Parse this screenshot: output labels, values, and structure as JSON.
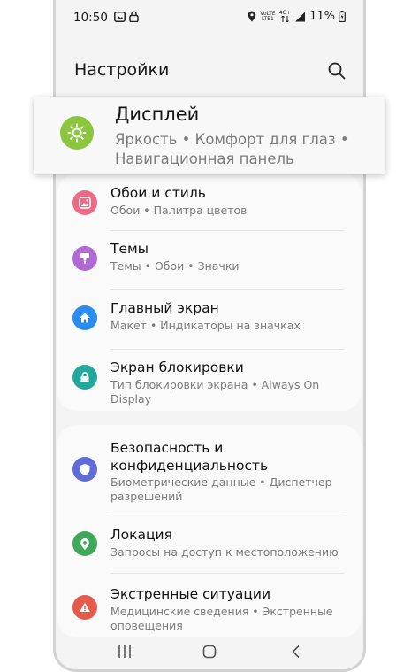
{
  "status_bar": {
    "time": "10:50",
    "battery": "11%",
    "volte_top": "VoLTE",
    "volte_bottom": "LTE1",
    "network": "4G+"
  },
  "header": {
    "title": "Настройки"
  },
  "highlight": {
    "title": "Дисплей",
    "subtitle": "Яркость  •  Комфорт для глаз  •  Навигационная панель"
  },
  "group1": [
    {
      "title": "Обои и стиль",
      "subtitle": "Обои  •  Палитра цветов"
    },
    {
      "title": "Темы",
      "subtitle": "Темы  •  Обои  •  Значки"
    },
    {
      "title": "Главный экран",
      "subtitle": "Макет  •  Индикаторы на значках"
    },
    {
      "title": "Экран блокировки",
      "subtitle": "Тип блокировки экрана  •  Always On Display"
    }
  ],
  "group2": [
    {
      "title": "Безопасность и конфиденциальность",
      "subtitle": "Биометрические данные  •  Диспетчер разрешений"
    },
    {
      "title": "Локация",
      "subtitle": "Запросы на доступ к местоположению"
    },
    {
      "title": "Экстренные ситуации",
      "subtitle": "Медицинские сведения  •  Экстренные оповещения"
    }
  ],
  "colors": {
    "display_icon": "#8cc63f",
    "wallpaper_icon": "#ec6a86",
    "themes_icon": "#b06ad6",
    "home_icon": "#2b8cf0",
    "lock_icon": "#22a89a",
    "security_icon": "#5f6bd9",
    "location_icon": "#3fa85a",
    "emergency_icon": "#e55a4a"
  }
}
